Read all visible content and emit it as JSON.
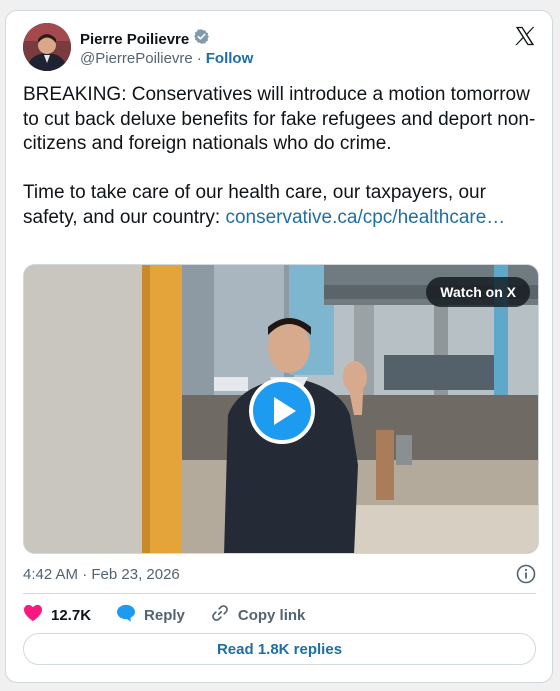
{
  "author": {
    "name": "Pierre Poilievre",
    "handle": "@PierrePoilievre",
    "separator": "·",
    "follow_label": "Follow",
    "verified_badge_icon": "verified-badge-icon",
    "avatar_icon": "avatar-photo"
  },
  "brand": {
    "logo_icon": "x-logo-icon"
  },
  "tweet": {
    "text": "BREAKING: Conservatives will introduce a motion tomorrow to cut back deluxe benefits for fake refugees and deport non-citizens and foreign nationals who do crime.\n\nTime to take care of our health care, our taxpayers, our safety, and our country: ",
    "link": "conservative.ca/cpc/healthcare…"
  },
  "media": {
    "watch_label": "Watch on X",
    "play_icon": "play-icon"
  },
  "meta": {
    "timestamp": "4:42 AM · Feb 23, 2026",
    "info_icon": "info-icon"
  },
  "actions": {
    "likes_count": "12.7K",
    "like_icon": "heart-icon",
    "reply_label": "Reply",
    "reply_icon": "reply-bubble-icon",
    "copy_link_label": "Copy link",
    "copy_link_icon": "link-icon"
  },
  "replies": {
    "label": "Read 1.8K replies"
  },
  "colors": {
    "accent": "#1d9bf0",
    "link": "#1d6fa6",
    "like": "#f91880",
    "muted": "#536471",
    "border": "#cfd9de"
  }
}
